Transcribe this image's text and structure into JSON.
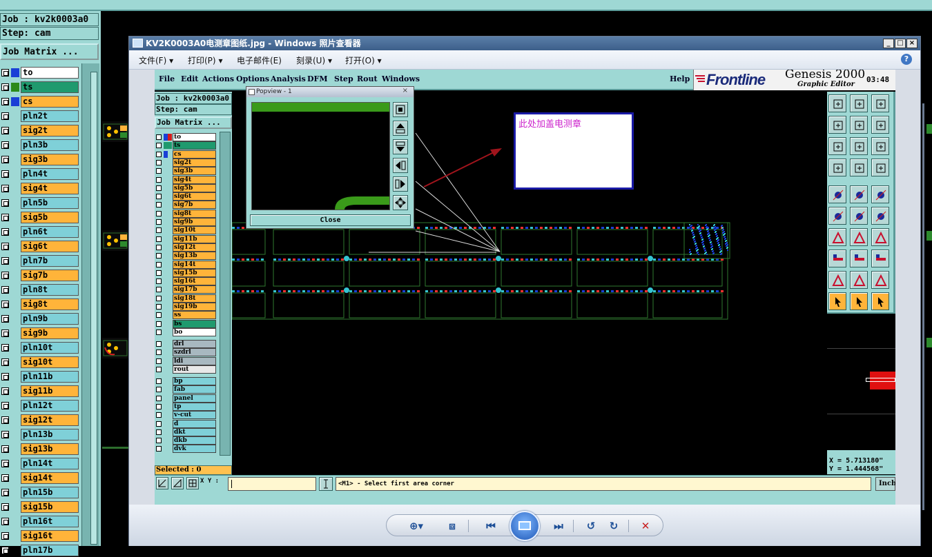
{
  "background": {
    "job_label": "Job : kv2k0003a0",
    "step_label": "Step: cam",
    "job_matrix_button": "Job Matrix ...",
    "layers": [
      {
        "name": "to",
        "color": "#ffffff",
        "dot": "#1a3fd6"
      },
      {
        "name": "ts",
        "color": "#1f9a6e",
        "dot": "#2b8a1a"
      },
      {
        "name": "cs",
        "color": "#ffb43a",
        "dot": "#1a3fd6"
      },
      {
        "name": "pln2t",
        "color": "#7fd0d8",
        "dot": ""
      },
      {
        "name": "sig2t",
        "color": "#ffb43a",
        "dot": ""
      },
      {
        "name": "pln3b",
        "color": "#7fd0d8",
        "dot": ""
      },
      {
        "name": "sig3b",
        "color": "#ffb43a",
        "dot": ""
      },
      {
        "name": "pln4t",
        "color": "#7fd0d8",
        "dot": ""
      },
      {
        "name": "sig4t",
        "color": "#ffb43a",
        "dot": ""
      },
      {
        "name": "pln5b",
        "color": "#7fd0d8",
        "dot": ""
      },
      {
        "name": "sig5b",
        "color": "#ffb43a",
        "dot": ""
      },
      {
        "name": "pln6t",
        "color": "#7fd0d8",
        "dot": ""
      },
      {
        "name": "sig6t",
        "color": "#ffb43a",
        "dot": ""
      },
      {
        "name": "pln7b",
        "color": "#7fd0d8",
        "dot": ""
      },
      {
        "name": "sig7b",
        "color": "#ffb43a",
        "dot": ""
      },
      {
        "name": "pln8t",
        "color": "#7fd0d8",
        "dot": ""
      },
      {
        "name": "sig8t",
        "color": "#ffb43a",
        "dot": ""
      },
      {
        "name": "pln9b",
        "color": "#7fd0d8",
        "dot": ""
      },
      {
        "name": "sig9b",
        "color": "#ffb43a",
        "dot": ""
      },
      {
        "name": "pln10t",
        "color": "#7fd0d8",
        "dot": ""
      },
      {
        "name": "sig10t",
        "color": "#ffb43a",
        "dot": ""
      },
      {
        "name": "pln11b",
        "color": "#7fd0d8",
        "dot": ""
      },
      {
        "name": "sig11b",
        "color": "#ffb43a",
        "dot": ""
      },
      {
        "name": "pln12t",
        "color": "#7fd0d8",
        "dot": ""
      },
      {
        "name": "sig12t",
        "color": "#ffb43a",
        "dot": ""
      },
      {
        "name": "pln13b",
        "color": "#7fd0d8",
        "dot": ""
      },
      {
        "name": "sig13b",
        "color": "#ffb43a",
        "dot": ""
      },
      {
        "name": "pln14t",
        "color": "#7fd0d8",
        "dot": ""
      },
      {
        "name": "sig14t",
        "color": "#ffb43a",
        "dot": ""
      },
      {
        "name": "pln15b",
        "color": "#7fd0d8",
        "dot": ""
      },
      {
        "name": "sig15b",
        "color": "#ffb43a",
        "dot": ""
      },
      {
        "name": "pln16t",
        "color": "#7fd0d8",
        "dot": ""
      },
      {
        "name": "sig16t",
        "color": "#ffb43a",
        "dot": ""
      },
      {
        "name": "pln17b",
        "color": "#7fd0d8",
        "dot": ""
      }
    ]
  },
  "viewer": {
    "title": "KV2K0003A0电测章图纸.jpg - Windows 照片查看器",
    "menu": [
      {
        "label": "文件(F)",
        "arrow": "▾"
      },
      {
        "label": "打印(P)",
        "arrow": "▾"
      },
      {
        "label": "电子邮件(E)",
        "arrow": ""
      },
      {
        "label": "刻录(U)",
        "arrow": "▾"
      },
      {
        "label": "打开(O)",
        "arrow": "▾"
      }
    ],
    "help_icon": "?",
    "window_buttons": {
      "minimize": "_",
      "maximize": "□",
      "close": "×"
    }
  },
  "genesis": {
    "menu": [
      "File",
      "Edit",
      "Actions",
      "Options",
      "Analysis",
      "DFM",
      "Step",
      "Rout",
      "Windows"
    ],
    "help": "Help",
    "brand_front": "Front",
    "brand_line": "line",
    "genesis_title": "Genesis 2000",
    "graphic_editor": "Graphic Editor",
    "time": "03:48",
    "job_label": "Job : kv2k0003a0",
    "step_label": "Step: cam",
    "job_matrix_button": "Job Matrix ...",
    "layers_board": [
      {
        "name": "to",
        "color": "#ffffff",
        "dot": "#1a3fd6",
        "dot2": "#d61a1a"
      },
      {
        "name": "ts",
        "color": "#1f9a6e",
        "dot": "#1f9a6e",
        "dot2": "#1f9a6e"
      },
      {
        "name": "cs",
        "color": "#ffb43a",
        "dot": "#1a3fd6",
        "dot2": ""
      },
      {
        "name": "sig2t",
        "color": "#ffb43a"
      },
      {
        "name": "sig3b",
        "color": "#ffb43a"
      },
      {
        "name": "sig4t",
        "color": "#ffb43a"
      },
      {
        "name": "sig5b",
        "color": "#ffb43a"
      },
      {
        "name": "sig6t",
        "color": "#ffb43a"
      },
      {
        "name": "sig7b",
        "color": "#ffb43a"
      },
      {
        "name": "sig8t",
        "color": "#ffb43a"
      },
      {
        "name": "sig9b",
        "color": "#ffb43a"
      },
      {
        "name": "sig10t",
        "color": "#ffb43a"
      },
      {
        "name": "sig11b",
        "color": "#ffb43a"
      },
      {
        "name": "sig12t",
        "color": "#ffb43a"
      },
      {
        "name": "sig13b",
        "color": "#ffb43a"
      },
      {
        "name": "sig14t",
        "color": "#ffb43a"
      },
      {
        "name": "sig15b",
        "color": "#ffb43a"
      },
      {
        "name": "sig16t",
        "color": "#ffb43a"
      },
      {
        "name": "sig17b",
        "color": "#ffb43a"
      },
      {
        "name": "sig18t",
        "color": "#ffb43a"
      },
      {
        "name": "sig19b",
        "color": "#ffb43a"
      },
      {
        "name": "ss",
        "color": "#ffb43a"
      },
      {
        "name": "bs",
        "color": "#1f9a6e"
      },
      {
        "name": "bo",
        "color": "#ffffff"
      }
    ],
    "layers_drill": [
      {
        "name": "drl",
        "color": "#a8b8c0"
      },
      {
        "name": "szdrl",
        "color": "#a8b8c0"
      },
      {
        "name": "ldi",
        "color": "#a8b8c0"
      },
      {
        "name": "rout",
        "color": "#e8e8e8"
      }
    ],
    "layers_misc": [
      {
        "name": "bp",
        "color": "#7fd0d8"
      },
      {
        "name": "fab",
        "color": "#7fd0d8"
      },
      {
        "name": "panel",
        "color": "#7fd0d8"
      },
      {
        "name": "tp",
        "color": "#7fd0d8"
      },
      {
        "name": "v-cut",
        "color": "#7fd0d8"
      },
      {
        "name": "d",
        "color": "#7fd0d8"
      },
      {
        "name": "dkt",
        "color": "#7fd0d8"
      },
      {
        "name": "dkb",
        "color": "#7fd0d8"
      },
      {
        "name": "dvk",
        "color": "#7fd0d8"
      }
    ],
    "selected": "Selected : 0",
    "coord_x": "X = 5.713180\"",
    "coord_y": "Y = 1.444568\"",
    "xy_label": "X Y :",
    "prompt": "<M1> - Select first area corner",
    "units": "Inch",
    "popview_title": "Popview - 1",
    "popview_close": "Close",
    "popview_x": "×",
    "annotation": "此处加盖电测章"
  }
}
